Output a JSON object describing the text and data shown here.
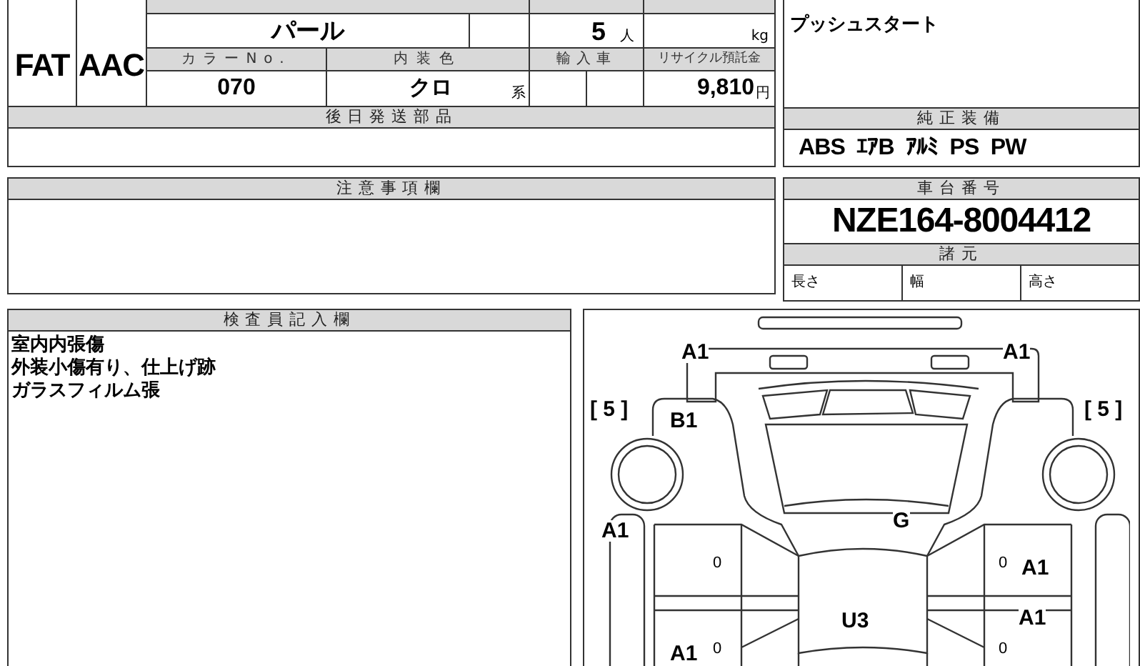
{
  "vehicle": {
    "shift": "FAT",
    "aircon": "AAC",
    "exterior_color": "パール",
    "capacity": {
      "value": "5",
      "unit": "人"
    },
    "max_load": {
      "unit": "kg"
    },
    "color_no_label": "カラーNo.",
    "interior_label": "内装色",
    "import_label": "輸入車",
    "recycle_label": "リサイクル預託金",
    "color_no": "070",
    "interior_color": "クロ",
    "interior_suffix": "系",
    "recycle_fee": {
      "value": "9,810",
      "unit": "円"
    }
  },
  "later_parts": {
    "label": "後日発送部品"
  },
  "notes": {
    "lines": [
      "プッシュスタート"
    ]
  },
  "equipment": {
    "label": "純正装備",
    "items": [
      "ABS",
      "ｴｱB",
      "ｱﾙﾐ",
      "PS",
      "PW"
    ]
  },
  "caution": {
    "label": "注意事項欄"
  },
  "chassis": {
    "label": "車台番号",
    "number": "NZE164-8004412",
    "specs_label": "諸元",
    "specs": [
      "長さ",
      "幅",
      "高さ"
    ]
  },
  "inspector": {
    "label": "検査員記入欄",
    "lines": [
      "室内内張傷",
      "外装小傷有り、仕上げ跡",
      "ガラスフィルム張"
    ]
  },
  "diagram": {
    "marks": [
      "A1",
      "A1",
      "[ 5 ]",
      "[ 5 ]",
      "B1",
      "A1",
      "G",
      "0",
      "0",
      "A1",
      "A1",
      "U3",
      "A1",
      "0",
      "0"
    ]
  }
}
